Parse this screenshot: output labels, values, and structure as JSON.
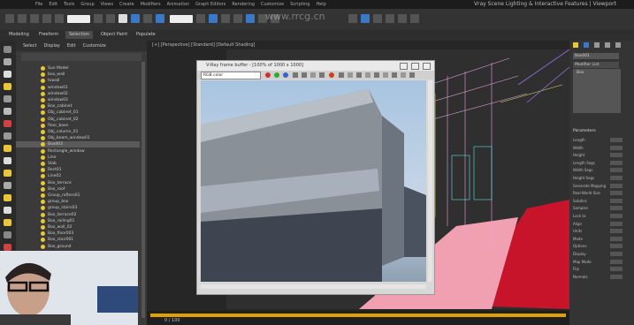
{
  "window": {
    "title": "Vray Scene Lighting & Interactive Features | Viewport",
    "menus": [
      "File",
      "Edit",
      "Tools",
      "Group",
      "Views",
      "Create",
      "Modifiers",
      "Animation",
      "Graph Editors",
      "Rendering",
      "Customize",
      "Scripting",
      "Help"
    ]
  },
  "watermark": "www.rrcg.cn",
  "ribbon_tabs": [
    "Modeling",
    "Freeform",
    "Selection",
    "Object Paint",
    "Populate"
  ],
  "explorer": {
    "tabs": [
      "Select",
      "Display",
      "Edit",
      "Customize"
    ],
    "rows": [
      "Sun Model",
      "box_wall",
      "tvwall",
      "window01",
      "window02",
      "window03",
      "Box_cabinet",
      "Obj_cabinet_01",
      "Obj_cabinet_02",
      "floor_base",
      "Obj_column_01",
      "Obj_beam_window01",
      "Box003",
      "Rectangle_window",
      "Line",
      "Slab",
      "Rect01",
      "Line02",
      "Box_terrace",
      "Box_roof",
      "Group_rafters01",
      "group_box",
      "group_stairs03",
      "Box_terrace02",
      "Box_railing01",
      "Box_wall_02",
      "Box_floor003",
      "Box_stair001",
      "Box_ground"
    ],
    "selected_index": 12
  },
  "viewport": {
    "label": "[+] [Perspective] [Standard] [Default Shading]"
  },
  "vfb": {
    "title": "V-Ray frame buffer - [100% of 1000 x 1000]",
    "channel": "RGB color"
  },
  "right_panel": {
    "object_name": "Box001",
    "modifier_list": "Modifier List",
    "stack_item": "Box",
    "rollout_title": "Parameters",
    "params": [
      "Length",
      "Width",
      "Height",
      "Length Segs",
      "Width Segs",
      "Height Segs",
      "Generate Mapping",
      "Real-World Size",
      "Subdivs",
      "Samples",
      "Lock to",
      "Align",
      "Units",
      "Mode",
      "Options",
      "Display",
      "Map Mode",
      "Flip",
      "Normals"
    ]
  },
  "timeline": {
    "frame": "0 / 100"
  },
  "colors": {
    "accent": "#3a78c8",
    "timeline": "#e0a100",
    "light_bulb": "#e8c53a"
  }
}
